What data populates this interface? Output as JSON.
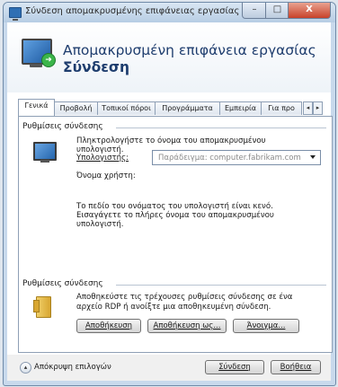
{
  "window": {
    "title": "Σύνδεση απομακρυσμένης επιφάνειας εργασίας",
    "controls": {
      "minimize": "–",
      "maximize": "□",
      "close": "X"
    }
  },
  "banner": {
    "line1": "Απομακρυσμένη επιφάνεια εργασίας",
    "line2": "Σύνδεση"
  },
  "tabs": [
    "Γενικά",
    "Προβολή",
    "Τοπικοί πόροι",
    "Προγράμματα",
    "Εμπειρία",
    "Για προ"
  ],
  "tab_scroll": {
    "left": "◂",
    "right": "▸"
  },
  "logon": {
    "section_title": "Ρυθμίσεις σύνδεσης",
    "instruction_line1": "Πληκτρολογήστε το όνομα του απομακρυσμένου",
    "instruction_line2": "υπολογιστή.",
    "computer_label": "Υπολογιστής:",
    "computer_placeholder": "Παράδειγμα: computer.fabrikam.com",
    "user_label": "Όνομα χρήστη:",
    "note_line1": "Το πεδίο του ονόματος του υπολογιστή είναι κενό.",
    "note_line2": "Εισαγάγετε το πλήρες όνομα του απομακρυσμένου",
    "note_line3": "υπολογιστή."
  },
  "connection": {
    "section_title": "Ρυθμίσεις σύνδεσης",
    "desc_line1": "Αποθηκεύστε τις τρέχουσες ρυθμίσεις σύνδεσης σε ένα",
    "desc_line2": "αρχείο RDP ή ανοίξτε μια αποθηκευμένη σύνδεση.",
    "save_button": "Αποθήκευση",
    "save_as_button": "Αποθήκευση ως...",
    "open_button": "Άνοιγμα..."
  },
  "footer": {
    "hide_options": "Απόκρυψη επιλογών",
    "connect_button": "Σύνδεση",
    "help_button": "Βοήθεια"
  }
}
